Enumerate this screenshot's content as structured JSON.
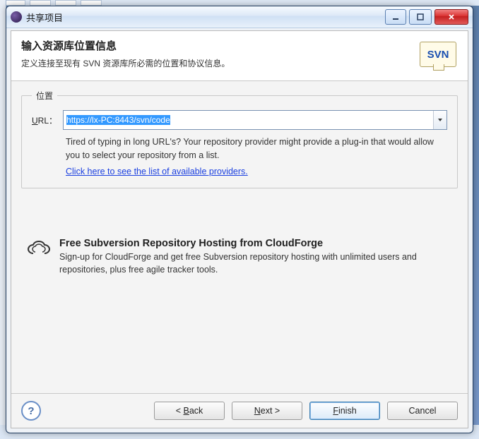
{
  "window": {
    "title": "共享项目"
  },
  "header": {
    "heading": "输入资源库位置信息",
    "subheading": "定义连接至现有 SVN 资源库所必需的位置和协议信息。",
    "logo_text": "SVN"
  },
  "location": {
    "legend": "位置",
    "url_label_prefix": "U",
    "url_label_rest": "RL：",
    "url_value": "https://lx-PC:8443/svn/code",
    "hint": "Tired of typing in long URL's?  Your repository provider might provide a plug-in that would allow you to select your repository from a list.",
    "providers_link": "Click here to see the list of available providers."
  },
  "promo": {
    "title": "Free Subversion Repository Hosting from CloudForge",
    "body": "Sign-up for CloudForge and get free Subversion repository hosting with unlimited users and repositories, plus free agile tracker tools."
  },
  "buttons": {
    "help": "?",
    "back_pre": "< ",
    "back_u": "B",
    "back_post": "ack",
    "next_u": "N",
    "next_post": "ext >",
    "finish_u": "F",
    "finish_post": "inish",
    "cancel": "Cancel"
  }
}
